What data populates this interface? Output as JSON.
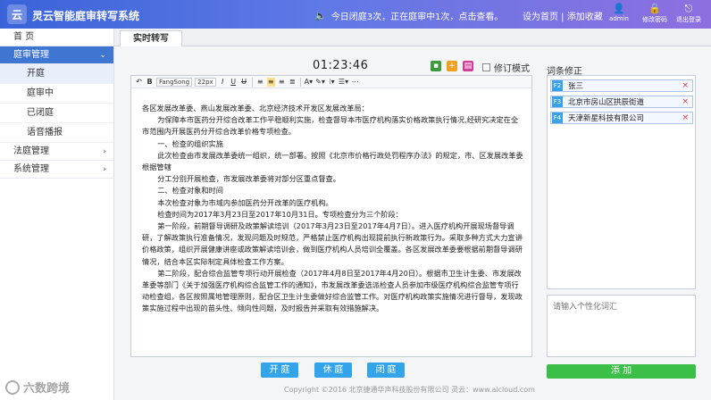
{
  "header": {
    "logo_text": "云",
    "app_title": "灵云智能庭审转写系统",
    "notice": "今日闭庭3次，正在庭审中1次，点击查看。",
    "set_home": "设为首页",
    "link_sep": " | ",
    "add_favorite": "添加收藏",
    "admin_label": "admin",
    "change_password_label": "修改密码",
    "logout_label": "退出登录"
  },
  "sidebar": {
    "home": "首 页",
    "trial_mgmt": "庭审管理",
    "trial_items": [
      "开庭",
      "庭审中",
      "已闭庭",
      "语音播报"
    ],
    "court_mgmt": "法庭管理",
    "system_mgmt": "系统管理"
  },
  "tabs": {
    "active": "实时转写"
  },
  "timer": "01:23:46",
  "revision_mode_label": "修订模式",
  "editor": {
    "toolbar": {
      "bold": "B",
      "font_family": "FangSong",
      "font_size": "22px",
      "italic": "I",
      "underline": "U",
      "strike": "U"
    },
    "paragraphs": [
      {
        "text": "各区发展改革委、燕山发展改革委、北京经济技术开发区发展改革局：",
        "indent": false
      },
      {
        "text": "为保障本市医药分开综合改革工作平稳顺利实施，检查督导本市医疗机构落实价格政策执行情况,经研究决定在全市范围内开展医药分开综合改革价格专项检查。",
        "indent": true
      },
      {
        "text": "一、检查的组织实施",
        "indent": true
      },
      {
        "text": "此次检查由市发展改革委统一组织，统一部署。按照《北京市价格行政处罚程序办法》的规定，市、区发展改革委根据管辖",
        "indent": true
      },
      {
        "text": "分工分别开展检查，市发展改革委将对部分区重点督查。",
        "indent": true
      },
      {
        "text": "二、检查对象和时间",
        "indent": true
      },
      {
        "text": "本次检查对象为市域内参加医药分开改革的医疗机构。",
        "indent": true
      },
      {
        "text": "检查时间为2017年3月23日至2017年10月31日。专项检查分为三个阶段：",
        "indent": true
      },
      {
        "text": "第一阶段，前期督导调研及政策解读培训（2017年3月23日至2017年4月7日）。进入医疗机构开展现场督导调研，了解政策执行准备情况，发现问题及时规范，严格禁止医疗机构出现提前执行新政策行为。采取多种方式大力宣讲价格政策，组织开展健康讲座或政策解读培训会，做到医疗机构人员培训全覆盖。各区发展改革委要根据前期督导调研情况，结合本区实际制定具体检查工作方案。",
        "indent": true
      },
      {
        "text": "第二阶段，配合综合监管专项行动开展检查（2017年4月8日至2017年4月20日）。根据市卫生计生委、市发展改革委等部门《关于加强医疗机构综合监管工作的通知》，市发展改革委选派检查人员参加市级医疗机构综合监管专项行动检查组，各区按照属地管理原则，配合区卫生计生委做好综合监管工作。对医疗机构政策实施情况进行督导，发现政策实施过程中出现的苗头性、倾向性问题，及时报告并采取有效措施解决。",
        "indent": true
      }
    ]
  },
  "actions": {
    "open": "开 庭",
    "recess": "休 庭",
    "close": "闭 庭"
  },
  "footer": "Copyright ©2016 北京捷通华声科技股份有限公司   灵云：www.aicloud.com",
  "right_panel": {
    "title": "词条修正",
    "terms": [
      {
        "key": "F2",
        "text": "张三"
      },
      {
        "key": "F3",
        "text": "北京市房山区拱辰街道"
      },
      {
        "key": "F4",
        "text": "天津新星科技有限公司"
      }
    ],
    "delete_symbol": "×",
    "input_placeholder": "请输入个性化词汇",
    "add_label": "添 加"
  },
  "watermark": "六数跨境",
  "colors": {
    "header_start": "#3a63d8",
    "header_end": "#8e6fe0",
    "sidebar_active": "#3f76d1",
    "action_button": "#33a4ea",
    "add_button": "#3cbf48",
    "delete_icon": "#e0383c",
    "term_key": "#3aa1e6"
  }
}
